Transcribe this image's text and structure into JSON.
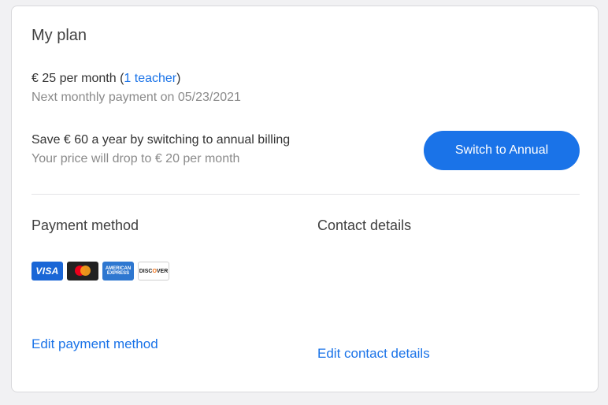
{
  "plan": {
    "title": "My plan",
    "price_prefix": "€ 25 per month (",
    "teacher_link": "1 teacher",
    "price_suffix": ")",
    "next_payment": "Next monthly payment on 05/23/2021",
    "save_text": "Save € 60 a year by switching to annual billing",
    "drop_text": "Your price will drop to € 20 per month",
    "switch_button": "Switch to Annual"
  },
  "payment": {
    "title": "Payment method",
    "cards": [
      {
        "name": "visa-card-icon",
        "label": "VISA"
      },
      {
        "name": "mastercard-card-icon",
        "label": ""
      },
      {
        "name": "amex-card-icon",
        "label_top": "AMERICAN",
        "label_bottom": "EXPRESS"
      },
      {
        "name": "discover-card-icon",
        "label": "DISC",
        "label_o": "O",
        "label_end": "VER"
      }
    ],
    "edit_link": "Edit payment method"
  },
  "contact": {
    "title": "Contact details",
    "edit_link": "Edit contact details"
  },
  "colors": {
    "accent": "#1a73e8",
    "muted_text": "#8a8a8a",
    "background": "#f1f1f3"
  }
}
